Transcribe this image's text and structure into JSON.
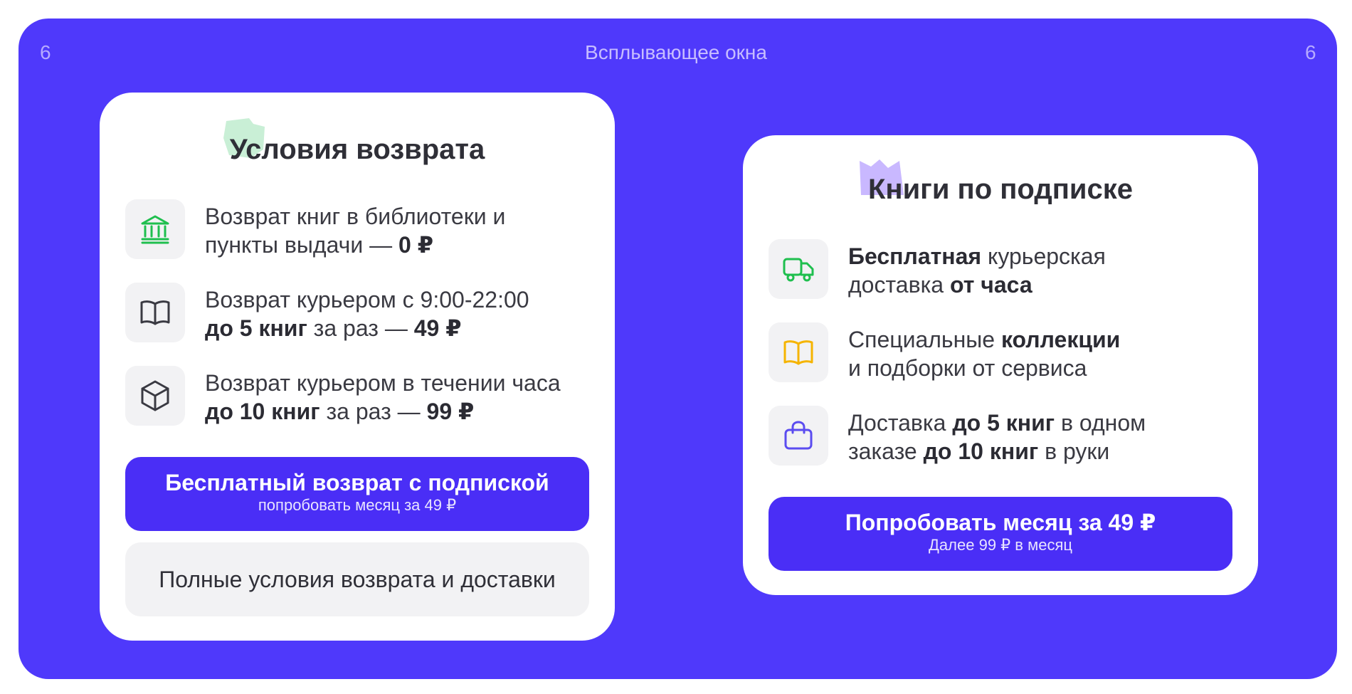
{
  "frame": {
    "number_left": "6",
    "number_right": "6",
    "title": "Всплывающее окна",
    "background_color": "#4f39fb"
  },
  "return_card": {
    "title": "Условия возврата",
    "items": [
      {
        "icon": "bank-building-icon",
        "icon_color": "#1fbf4e",
        "line1": [
          {
            "text": "Возврат книг в библиотеки и"
          }
        ],
        "line2": [
          {
            "text": "пункты выдачи — "
          },
          {
            "text": "0 ₽",
            "bold": true
          }
        ]
      },
      {
        "icon": "open-book-icon",
        "icon_color": "#3a3a42",
        "line1": [
          {
            "text": "Возврат курьером с 9:00-22:00"
          }
        ],
        "line2": [
          {
            "text": "до 5 книг",
            "bold": true
          },
          {
            "text": " за раз — "
          },
          {
            "text": "49 ₽",
            "bold": true
          }
        ]
      },
      {
        "icon": "box-cube-icon",
        "icon_color": "#3a3a42",
        "line1": [
          {
            "text": "Возврат курьером в течении часа"
          }
        ],
        "line2": [
          {
            "text": "до 10 книг",
            "bold": true
          },
          {
            "text": " за раз — "
          },
          {
            "text": "99 ₽",
            "bold": true
          }
        ]
      }
    ],
    "primary_button": {
      "label": "Бесплатный возврат с подпиской",
      "sublabel": "попробовать месяц за 49 ₽"
    },
    "secondary_button": {
      "label": "Полные условия возврата и доставки"
    }
  },
  "subscription_card": {
    "title": "Книги по подписке",
    "items": [
      {
        "icon": "delivery-truck-icon",
        "icon_color": "#1fbf4e",
        "line1": [
          {
            "text": "Бесплатная",
            "bold": true
          },
          {
            "text": " курьерская"
          }
        ],
        "line2": [
          {
            "text": "доставка "
          },
          {
            "text": "от часа",
            "bold": true
          }
        ]
      },
      {
        "icon": "open-book-icon",
        "icon_color": "#f5b400",
        "line1": [
          {
            "text": "Специальные "
          },
          {
            "text": "коллекции",
            "bold": true
          }
        ],
        "line2": [
          {
            "text": "и подборки от сервиса"
          }
        ]
      },
      {
        "icon": "shopping-bag-icon",
        "icon_color": "#5b4cf0",
        "line1": [
          {
            "text": "Доставка "
          },
          {
            "text": "до 5 книг",
            "bold": true
          },
          {
            "text": " в одном"
          }
        ],
        "line2": [
          {
            "text": "заказе "
          },
          {
            "text": "до 10 книг",
            "bold": true
          },
          {
            "text": " в руки"
          }
        ]
      }
    ],
    "primary_button": {
      "label": "Попробовать месяц за 49 ₽",
      "sublabel": "Далее 99 ₽ в месяц"
    }
  },
  "colors": {
    "button_primary": "#4a2ef6",
    "icon_tile": "#f2f2f4",
    "decor_green": "#c9efd6",
    "decor_lavender": "#c9b8ff"
  }
}
